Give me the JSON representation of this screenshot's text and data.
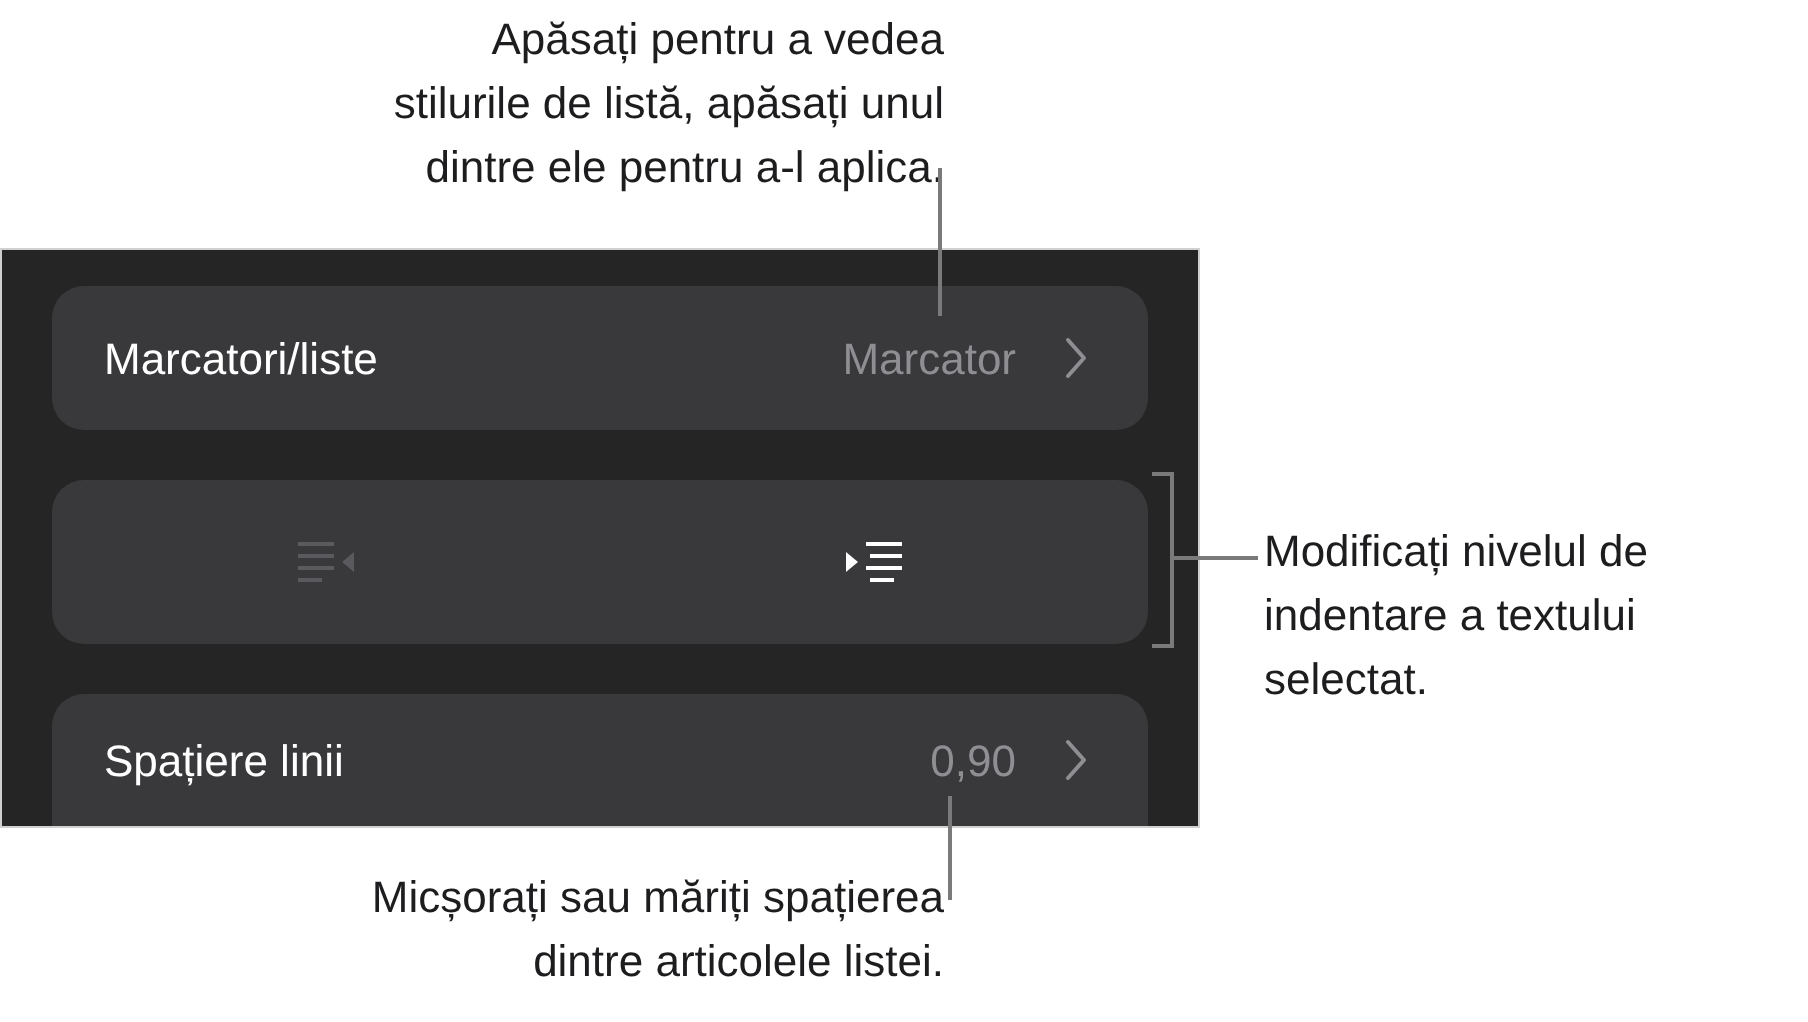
{
  "callouts": [
    {
      "lines": [
        "Apăsați pentru a vedea",
        "stilurile de listă, apăsați unul",
        "dintre ele pentru a-l aplica."
      ]
    },
    {
      "lines": [
        "Modificați nivelul de",
        "indentare a textului",
        "selectat."
      ]
    },
    {
      "lines": [
        "Micșorați sau măriți spațierea",
        "dintre articolele listei."
      ]
    }
  ],
  "panel": {
    "rows": [
      {
        "kind": "disclosure",
        "label": "Marcatori/liste",
        "value": "Marcator"
      },
      {
        "kind": "indent",
        "buttons": [
          {
            "kind": "outdent",
            "disabled": true
          },
          {
            "kind": "indent",
            "disabled": false
          }
        ]
      },
      {
        "kind": "disclosure",
        "label": "Spațiere linii",
        "value": "0,90"
      }
    ]
  }
}
